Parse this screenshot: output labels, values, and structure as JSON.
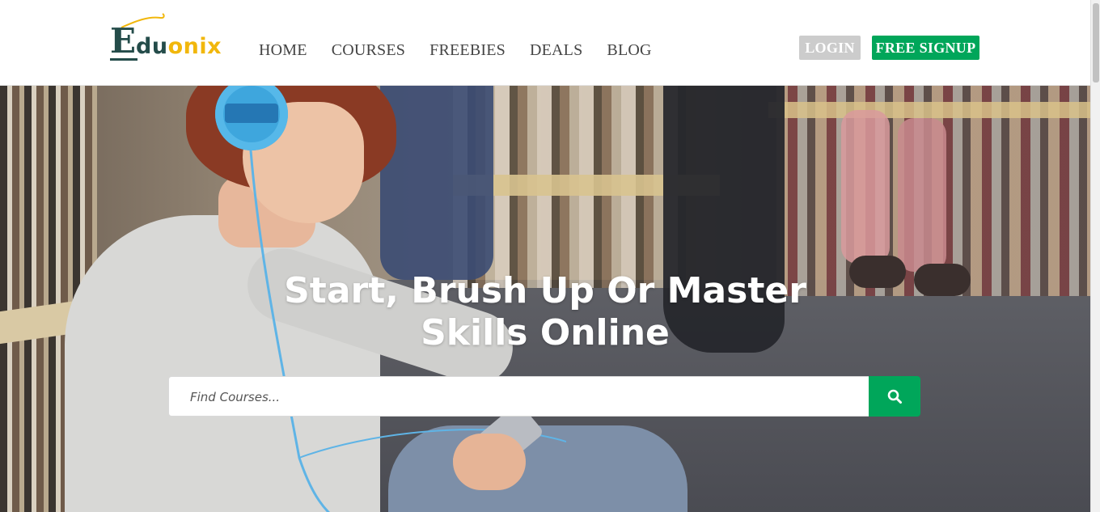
{
  "header": {
    "logo": {
      "e": "E",
      "du": "du",
      "onix": "onix"
    },
    "nav": [
      {
        "label": "HOME"
      },
      {
        "label": "COURSES"
      },
      {
        "label": "FREEBIES"
      },
      {
        "label": "DEALS"
      },
      {
        "label": "BLOG"
      }
    ],
    "login_label": "LOGIN",
    "signup_label": "FREE SIGNUP"
  },
  "hero": {
    "title_line1": "Start, Brush Up Or Master",
    "title_line2": "Skills Online"
  },
  "search": {
    "placeholder": "Find Courses...",
    "value": "",
    "icon": "search-icon"
  },
  "colors": {
    "brand_green": "#00a65a",
    "logo_teal": "#244c4a",
    "logo_yellow": "#f1b70c",
    "login_gray": "#cccccc",
    "nav_text": "#444444"
  }
}
